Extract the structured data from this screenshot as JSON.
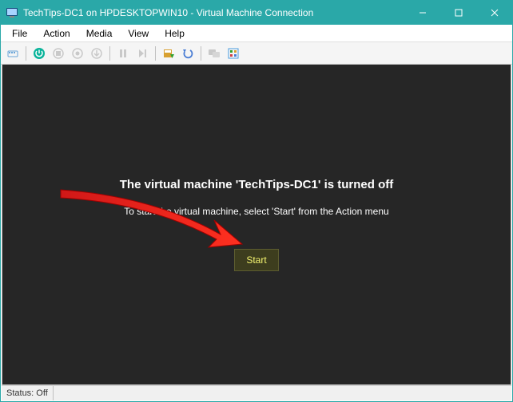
{
  "window": {
    "title": "TechTips-DC1 on HPDESKTOPWIN10 - Virtual Machine Connection"
  },
  "menu": {
    "file": "File",
    "action": "Action",
    "media": "Media",
    "view": "View",
    "help": "Help"
  },
  "toolbar_icons": {
    "ctrl_alt_del": "ctrl-alt-del-icon",
    "start": "start-icon",
    "turnoff": "turnoff-icon",
    "shutdown": "shutdown-icon",
    "save": "save-icon",
    "pause": "pause-icon",
    "reset": "reset-icon",
    "checkpoint": "checkpoint-icon",
    "revert": "revert-icon",
    "enhanced": "enhanced-session-icon",
    "share": "share-icon"
  },
  "vm": {
    "heading": "The virtual machine 'TechTips-DC1' is turned off",
    "subtext": "To start the virtual machine, select 'Start' from the Action menu",
    "start_button": "Start"
  },
  "status": {
    "label": "Status: Off"
  }
}
